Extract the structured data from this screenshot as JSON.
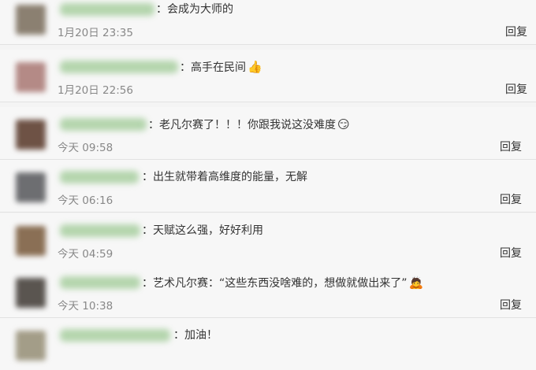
{
  "comments": [
    {
      "text": "：会成为大师的",
      "emoji": "",
      "time": "1月20日 23:35",
      "reply": "回复",
      "avatar_color": "#8b8071"
    },
    {
      "text": "：高手在民间",
      "emoji": "👍",
      "time": "1月20日 22:56",
      "reply": "回复",
      "avatar_color": "#b48a86"
    },
    {
      "text": "：老凡尔赛了！！！你跟我说这没难度",
      "emoji": "😏",
      "time": "今天 09:58",
      "reply": "回复",
      "avatar_color": "#6e5245"
    },
    {
      "text": "：出生就带着高维度的能量，无解",
      "emoji": "",
      "time": "今天 06:16",
      "reply": "回复",
      "avatar_color": "#6d6e71"
    },
    {
      "text": "：天赋这么强，好好利用",
      "emoji": "",
      "time": "今天 04:59",
      "reply": "回复",
      "avatar_color": "#8a6f55"
    },
    {
      "text": "：艺术凡尔赛：“这些东西没啥难的，想做就做出来了”",
      "emoji": "🙇",
      "time": "今天 10:38",
      "reply": "回复",
      "avatar_color": "#5a5550"
    },
    {
      "text": "：加油！",
      "emoji": "",
      "time": "",
      "reply": "",
      "avatar_color": "#a39d88"
    }
  ]
}
